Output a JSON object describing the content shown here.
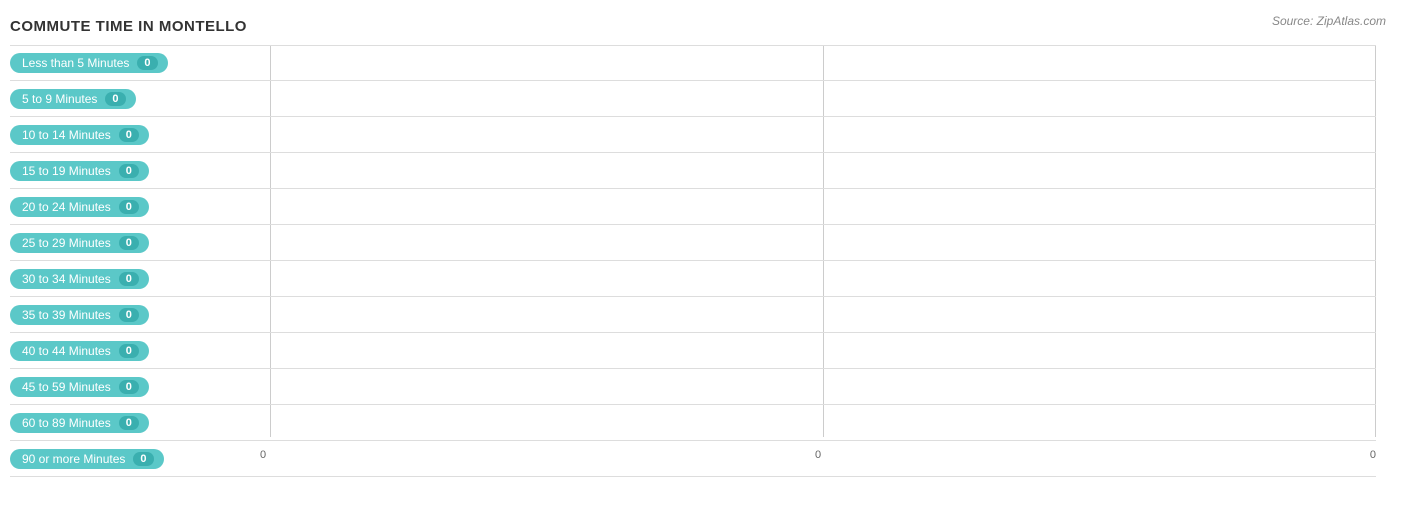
{
  "title": "COMMUTE TIME IN MONTELLO",
  "source": "Source: ZipAtlas.com",
  "rows": [
    {
      "label": "Less than 5 Minutes",
      "value": 0
    },
    {
      "label": "5 to 9 Minutes",
      "value": 0
    },
    {
      "label": "10 to 14 Minutes",
      "value": 0
    },
    {
      "label": "15 to 19 Minutes",
      "value": 0
    },
    {
      "label": "20 to 24 Minutes",
      "value": 0
    },
    {
      "label": "25 to 29 Minutes",
      "value": 0
    },
    {
      "label": "30 to 34 Minutes",
      "value": 0
    },
    {
      "label": "35 to 39 Minutes",
      "value": 0
    },
    {
      "label": "40 to 44 Minutes",
      "value": 0
    },
    {
      "label": "45 to 59 Minutes",
      "value": 0
    },
    {
      "label": "60 to 89 Minutes",
      "value": 0
    },
    {
      "label": "90 or more Minutes",
      "value": 0
    }
  ],
  "xAxisLabels": [
    "0",
    "0",
    "0"
  ],
  "colors": {
    "pill_bg": "#5bc8c8",
    "pill_value_bg": "#3da8a8",
    "grid_line": "#cccccc",
    "row_border": "#dddddd"
  }
}
